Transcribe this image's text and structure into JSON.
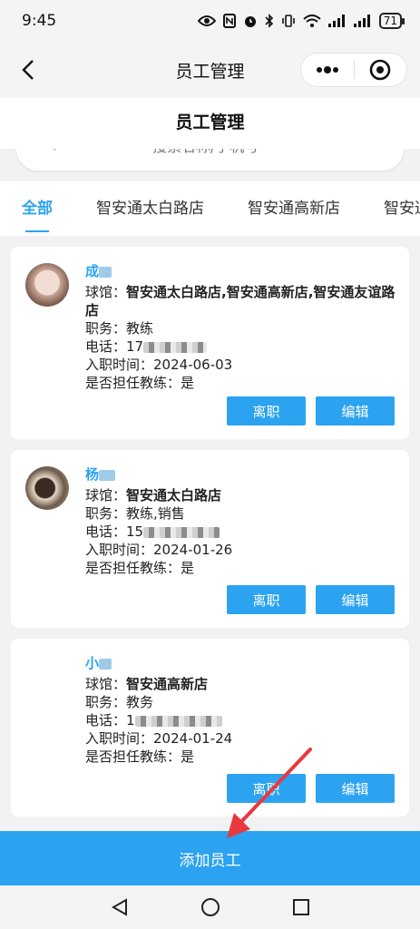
{
  "status_bar": {
    "time": "9:45",
    "battery": "71"
  },
  "nav": {
    "title": "员工管理"
  },
  "page": {
    "header": "员工管理"
  },
  "search": {
    "placeholder": "搜索名称/手机号"
  },
  "tabs": [
    {
      "label": "全部",
      "active": true
    },
    {
      "label": "智安通太白路店",
      "active": false
    },
    {
      "label": "智安通高新店",
      "active": false
    },
    {
      "label": "智安通",
      "active": false
    }
  ],
  "labels": {
    "venue": "球馆：",
    "position": "职务：",
    "phone": "电话：",
    "hire_date": "入职时间：",
    "is_coach": "是否担任教练：",
    "resign": "离职",
    "edit": "编辑"
  },
  "employees": [
    {
      "name": "成",
      "venue": "智安通太白路店,智安通高新店,智安通友谊路店",
      "position": "教练",
      "phone": "17",
      "hire_date": "2024-06-03",
      "is_coach": "是"
    },
    {
      "name": "杨",
      "venue": "智安通太白路店",
      "position": "教练,销售",
      "phone": "15",
      "hire_date": "2024-01-26",
      "is_coach": "是"
    },
    {
      "name": "小",
      "venue": "智安通高新店",
      "position": "教务",
      "phone": "1",
      "hire_date": "2024-01-24",
      "is_coach": "是"
    }
  ],
  "footer": {
    "add_button": "添加员工"
  },
  "colors": {
    "accent": "#2ba3f0",
    "background": "#f2f2f2"
  }
}
